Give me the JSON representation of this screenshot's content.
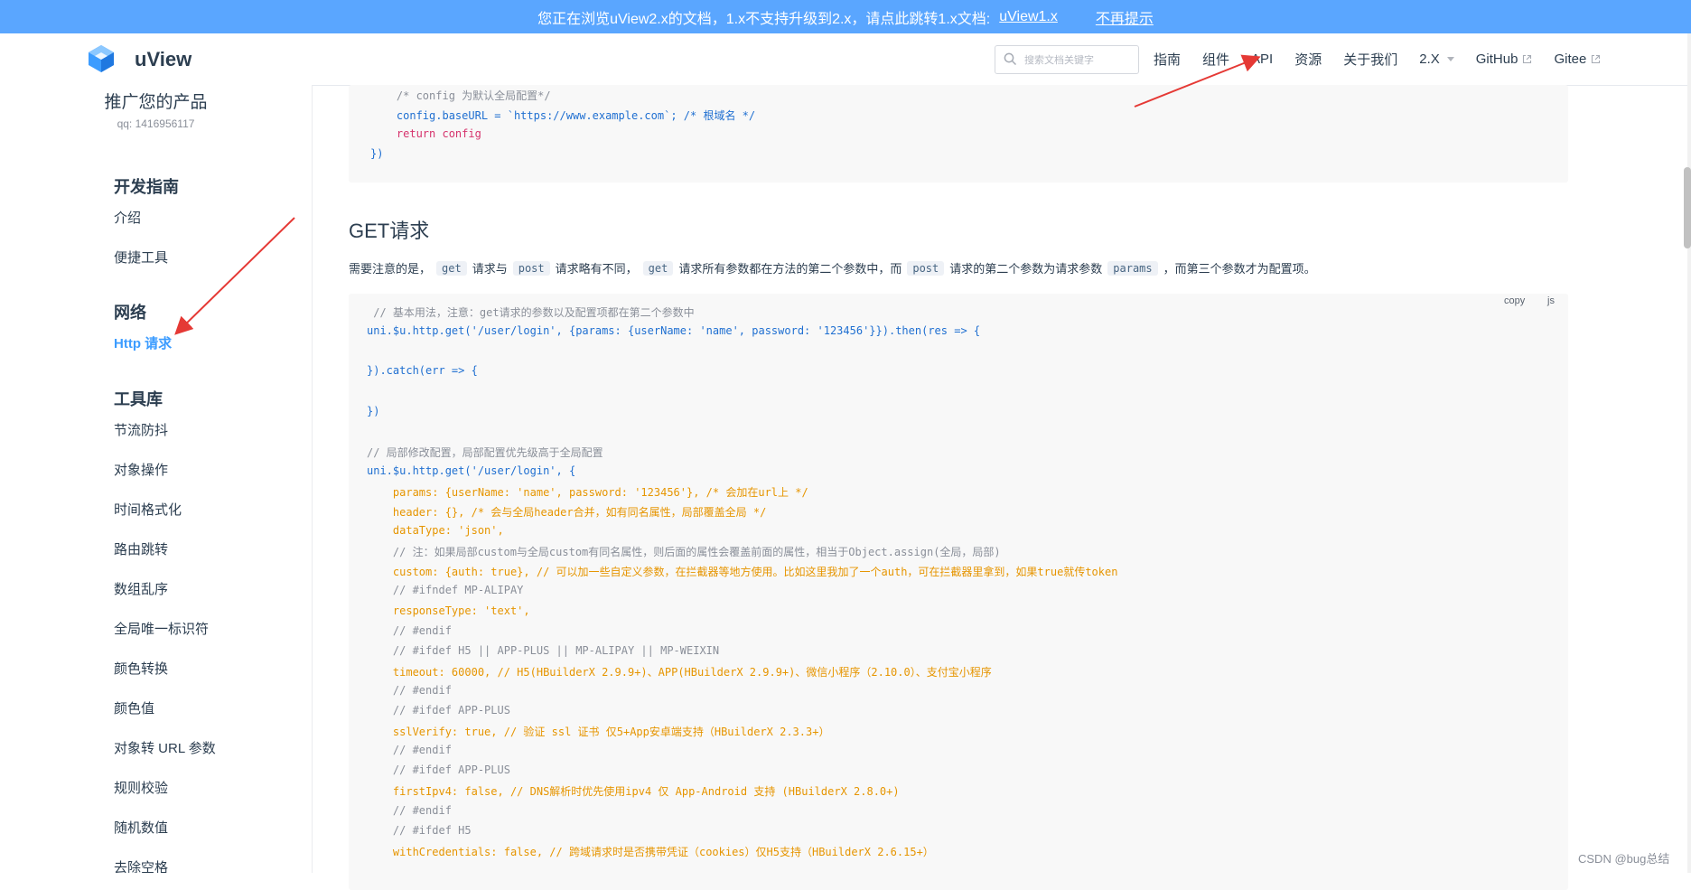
{
  "notice": {
    "text": "您正在浏览uView2.x的文档，1.x不支持升级到2.x，请点此跳转1.x文档:",
    "link_label": "uView1.x",
    "dismiss_label": "不再提示"
  },
  "header": {
    "brand": "uView",
    "search_placeholder": "搜索文档关键字",
    "nav": {
      "guide": "指南",
      "components": "组件",
      "api": "API",
      "resources": "资源",
      "about": "关于我们",
      "version": "2.X",
      "github": "GitHub",
      "gitee": "Gitee"
    }
  },
  "sidebar": {
    "promo_title": "推广您的产品",
    "promo_qq": "qq: 1416956117",
    "groups": [
      {
        "title": "开发指南",
        "items": [
          "介绍",
          "便捷工具"
        ]
      },
      {
        "title": "网络",
        "items": [
          "Http 请求"
        ]
      },
      {
        "title": "工具库",
        "items": [
          "节流防抖",
          "对象操作",
          "时间格式化",
          "路由跳转",
          "数组乱序",
          "全局唯一标识符",
          "颜色转换",
          "颜色值",
          "对象转 URL 参数",
          "规则校验",
          "随机数值",
          "去除空格"
        ]
      }
    ]
  },
  "content": {
    "top_code": [
      "    /* config 为默认全局配置*/",
      "    config.baseURL = `https://www.example.com`; /* 根域名 */",
      "    return config",
      "})"
    ],
    "heading": "GET请求",
    "para": {
      "t1": "需要注意的是，",
      "c1": "get",
      "t2": "请求与",
      "c2": "post",
      "t3": "请求略有不同，",
      "c3": "get",
      "t4": "请求所有参数都在方法的第二个参数中，而",
      "c4": "post",
      "t5": "请求的第二个参数为请求参数",
      "c5": "params",
      "t6": "，而第三个参数才为配置项。"
    },
    "copy_label": "copy",
    "lang_label": "js",
    "code": [
      " // 基本用法，注意：get请求的参数以及配置项都在第二个参数中",
      "uni.$u.http.get('/user/login', {params: {userName: 'name', password: '123456'}}).then(res => {",
      "",
      "}).catch(err => {",
      "",
      "})",
      "",
      "// 局部修改配置，局部配置优先级高于全局配置",
      "uni.$u.http.get('/user/login', {",
      "    params: {userName: 'name', password: '123456'}, /* 会加在url上 */",
      "    header: {}, /* 会与全局header合并，如有同名属性，局部覆盖全局 */",
      "    dataType: 'json',",
      "    // 注：如果局部custom与全局custom有同名属性，则后面的属性会覆盖前面的属性，相当于Object.assign(全局，局部)",
      "    custom: {auth: true}, // 可以加一些自定义参数，在拦截器等地方使用。比如这里我加了一个auth，可在拦截器里拿到，如果true就传token",
      "    // #ifndef MP-ALIPAY",
      "    responseType: 'text',",
      "    // #endif",
      "    // #ifdef H5 || APP-PLUS || MP-ALIPAY || MP-WEIXIN",
      "    timeout: 60000, // H5(HBuilderX 2.9.9+)、APP(HBuilderX 2.9.9+)、微信小程序（2.10.0）、支付宝小程序",
      "    // #endif",
      "    // #ifdef APP-PLUS",
      "    sslVerify: true, // 验证 ssl 证书 仅5+App安卓端支持（HBuilderX 2.3.3+）",
      "    // #endif",
      "    // #ifdef APP-PLUS",
      "    firstIpv4: false, // DNS解析时优先使用ipv4 仅 App-Android 支持 (HBuilderX 2.8.0+)",
      "    // #endif",
      "    // #ifdef H5",
      "    withCredentials: false, // 跨域请求时是否携带凭证（cookies）仅H5支持（HBuilderX 2.6.15+）"
    ],
    "watermark": "CSDN @bug总结",
    "colors": {
      "accent": "#3c9cff",
      "banner": "#5aa6ff",
      "annotation_arrow": "#e53935"
    }
  }
}
